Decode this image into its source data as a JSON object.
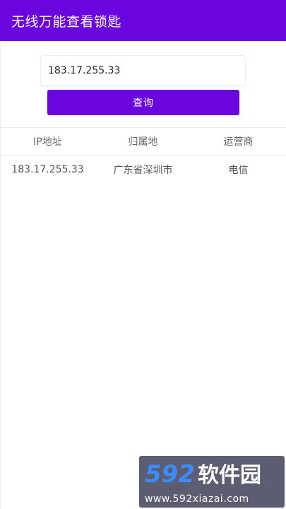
{
  "app_bar": {
    "title": "无线万能查看锁匙"
  },
  "search": {
    "value": "183.17.255.33"
  },
  "query_button": {
    "label": "查询"
  },
  "table": {
    "headers": [
      "IP地址",
      "归属地",
      "运营商"
    ],
    "rows": [
      [
        "183.17.255.33",
        "广东省深圳市",
        "电信"
      ]
    ]
  },
  "watermark": {
    "logo_number": "592",
    "logo_text": "软件园",
    "url": "www.592xiazai.com"
  },
  "colors": {
    "accent": "#6a05e0"
  }
}
